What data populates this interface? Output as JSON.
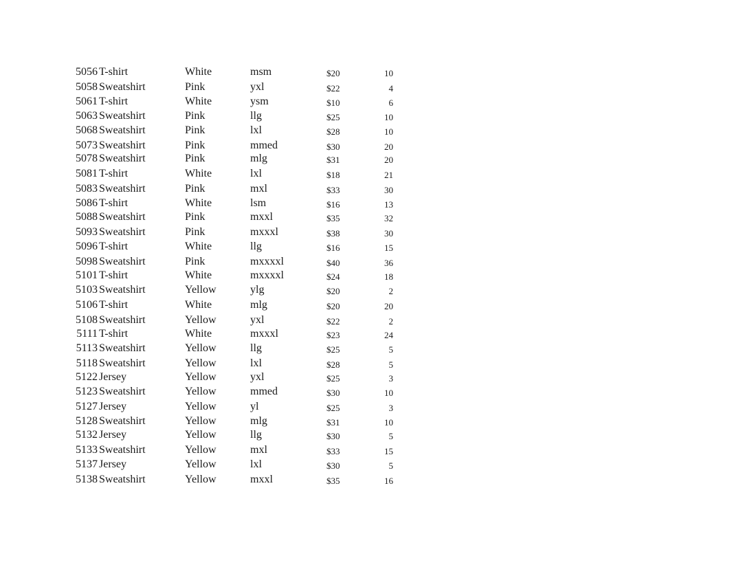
{
  "table": {
    "rows": [
      [
        "5056",
        "T-shirt",
        "White",
        "msm",
        "$20",
        "10"
      ],
      [
        "5058",
        "Sweatshirt",
        "Pink",
        "yxl",
        "$22",
        "4"
      ],
      [
        "5061",
        "T-shirt",
        "White",
        "ysm",
        "$10",
        "6"
      ],
      [
        "5063",
        "Sweatshirt",
        "Pink",
        "llg",
        "$25",
        "10"
      ],
      [
        "5068",
        "Sweatshirt",
        "Pink",
        "lxl",
        "$28",
        "10"
      ],
      [
        "5073",
        "Sweatshirt",
        "Pink",
        "mmed",
        "$30",
        "20"
      ],
      [
        "5078",
        "Sweatshirt",
        "Pink",
        "mlg",
        "$31",
        "20"
      ],
      [
        "5081",
        "T-shirt",
        "White",
        "lxl",
        "$18",
        "21"
      ],
      [
        "5083",
        "Sweatshirt",
        "Pink",
        "mxl",
        "$33",
        "30"
      ],
      [
        "5086",
        "T-shirt",
        "White",
        "lsm",
        "$16",
        "13"
      ],
      [
        "5088",
        "Sweatshirt",
        "Pink",
        "mxxl",
        "$35",
        "32"
      ],
      [
        "5093",
        "Sweatshirt",
        "Pink",
        "mxxxl",
        "$38",
        "30"
      ],
      [
        "5096",
        "T-shirt",
        "White",
        "llg",
        "$16",
        "15"
      ],
      [
        "5098",
        "Sweatshirt",
        "Pink",
        "mxxxxl",
        "$40",
        "36"
      ],
      [
        "5101",
        "T-shirt",
        "White",
        "mxxxxl",
        "$24",
        "18"
      ],
      [
        "5103",
        "Sweatshirt",
        "Yellow",
        "ylg",
        "$20",
        "2"
      ],
      [
        "5106",
        "T-shirt",
        "White",
        "mlg",
        "$20",
        "20"
      ],
      [
        "5108",
        "Sweatshirt",
        "Yellow",
        "yxl",
        "$22",
        "2"
      ],
      [
        "5111",
        "T-shirt",
        "White",
        "mxxxl",
        "$23",
        "24"
      ],
      [
        "5113",
        "Sweatshirt",
        "Yellow",
        "llg",
        "$25",
        "5"
      ],
      [
        "5118",
        "Sweatshirt",
        "Yellow",
        "lxl",
        "$28",
        "5"
      ],
      [
        "5122",
        "Jersey",
        "Yellow",
        "yxl",
        "$25",
        "3"
      ],
      [
        "5123",
        "Sweatshirt",
        "Yellow",
        "mmed",
        "$30",
        "10"
      ],
      [
        "5127",
        "Jersey",
        "Yellow",
        "yl",
        "$25",
        "3"
      ],
      [
        "5128",
        "Sweatshirt",
        "Yellow",
        "mlg",
        "$31",
        "10"
      ],
      [
        "5132",
        "Jersey",
        "Yellow",
        "llg",
        "$30",
        "5"
      ],
      [
        "5133",
        "Sweatshirt",
        "Yellow",
        "mxl",
        "$33",
        "15"
      ],
      [
        "5137",
        "Jersey",
        "Yellow",
        "lxl",
        "$30",
        "5"
      ],
      [
        "5138",
        "Sweatshirt",
        "Yellow",
        "mxxl",
        "$35",
        "16"
      ]
    ]
  }
}
